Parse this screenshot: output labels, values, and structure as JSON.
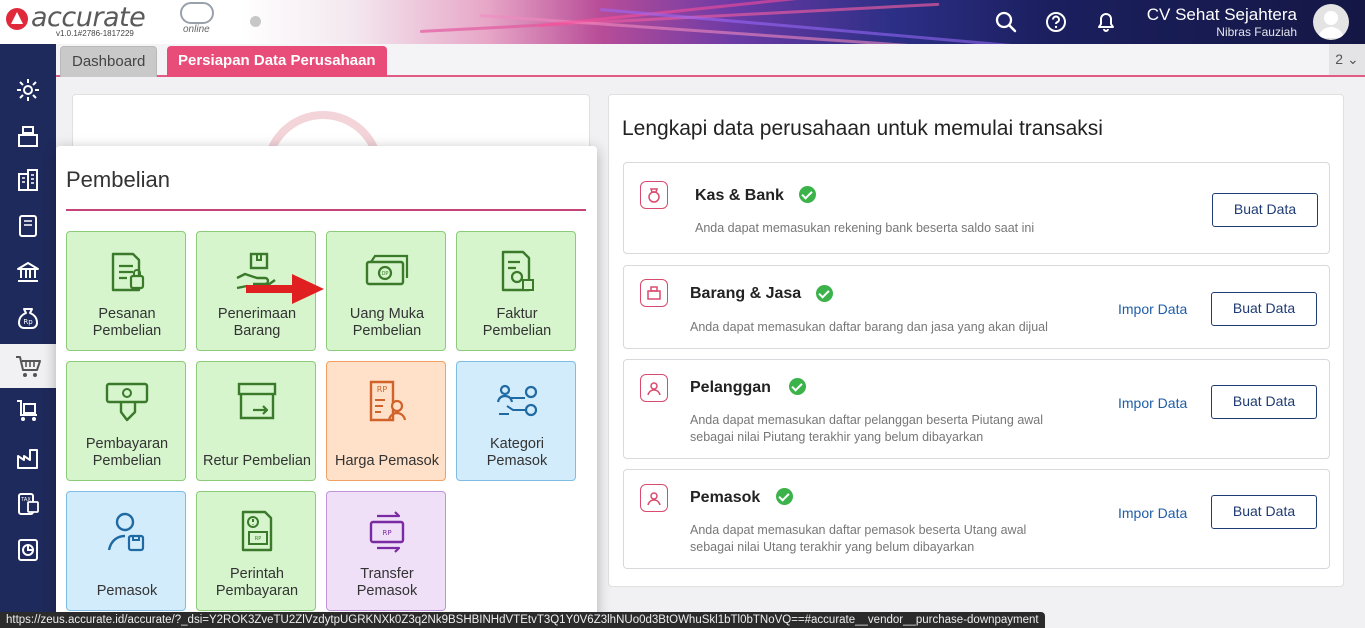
{
  "header": {
    "logo_text": "accurate",
    "logo_sub": "online",
    "version": "v1.0.1#2786-1817229",
    "company_name": "CV Sehat Sejahtera",
    "user_name": "Nibras Fauziah",
    "icons": [
      "search-icon",
      "help-icon",
      "bell-icon",
      "avatar"
    ]
  },
  "sidebar": {
    "items": [
      {
        "icon": "gear-icon"
      },
      {
        "icon": "cash-register-icon"
      },
      {
        "icon": "building-icon"
      },
      {
        "icon": "book-icon"
      },
      {
        "icon": "bank-icon"
      },
      {
        "icon": "money-bag-icon"
      },
      {
        "icon": "cart-icon",
        "active": true
      },
      {
        "icon": "warehouse-icon"
      },
      {
        "icon": "factory-icon"
      },
      {
        "icon": "tax-icon"
      },
      {
        "icon": "report-icon"
      }
    ]
  },
  "tabs": {
    "dashboard": "Dashboard",
    "persiapan": "Persiapan Data Perusahaan",
    "count": "2"
  },
  "popup": {
    "title": "Pembelian",
    "tiles": [
      {
        "line1": "Pesanan",
        "line2": "Pembelian",
        "color": "green"
      },
      {
        "line1": "Penerimaan",
        "line2": "Barang",
        "color": "green"
      },
      {
        "line1": "Uang Muka",
        "line2": "Pembelian",
        "color": "green"
      },
      {
        "line1": "Faktur",
        "line2": "Pembelian",
        "color": "green"
      },
      {
        "line1": "Pembayaran",
        "line2": "Pembelian",
        "color": "green"
      },
      {
        "line1": "Retur Pembelian",
        "line2": "",
        "color": "green"
      },
      {
        "line1": "Harga Pemasok",
        "line2": "",
        "color": "orange"
      },
      {
        "line1": "Kategori",
        "line2": "Pemasok",
        "color": "blue"
      },
      {
        "line1": "Pemasok",
        "line2": "",
        "color": "blue"
      },
      {
        "line1": "Perintah",
        "line2": "Pembayaran",
        "color": "green"
      },
      {
        "line1": "Transfer",
        "line2": "Pemasok",
        "color": "purple"
      }
    ]
  },
  "right": {
    "title": "Lengkapi data perusahaan untuk memulai transaksi",
    "items": [
      {
        "title": "Kas & Bank",
        "desc1": "Anda dapat memasukan rekening bank beserta saldo saat ini",
        "desc2": "",
        "buat": "Buat Data",
        "impor": ""
      },
      {
        "title": "Barang & Jasa",
        "desc1": "Anda dapat memasukan daftar barang dan jasa yang akan dijual",
        "desc2": "",
        "buat": "Buat Data",
        "impor": "Impor Data"
      },
      {
        "title": "Pelanggan",
        "desc1": "Anda dapat memasukan daftar pelanggan beserta Piutang awal",
        "desc2": "sebagai nilai Piutang terakhir yang belum dibayarkan",
        "buat": "Buat Data",
        "impor": "Impor Data"
      },
      {
        "title": "Pemasok",
        "desc1": "Anda dapat memasukan daftar pemasok beserta Utang awal",
        "desc2": "sebagai nilai Utang terakhir yang belum dibayarkan",
        "buat": "Buat Data",
        "impor": "Impor Data"
      }
    ]
  },
  "statusbar": {
    "url": "https://zeus.accurate.id/accurate/?_dsi=Y2ROK3ZveTU2ZlVzdytpUGRKNXk0Z3q2Nk9BSHBINHdVTEtvT3Q1Y0V6Z3lhNUo0d3BtOWhuSkl1bTl0bTNoVQ==#accurate__vendor__purchase-downpayment"
  },
  "colors": {
    "sidebar": "#1f2a5c",
    "accent": "#e84c78",
    "tile_green": "#d6f5cd",
    "tile_orange": "#ffe0c8",
    "tile_blue": "#d3ecfb",
    "tile_purple": "#efe0f8",
    "check": "#3cb34a",
    "arrow": "#e02020"
  }
}
